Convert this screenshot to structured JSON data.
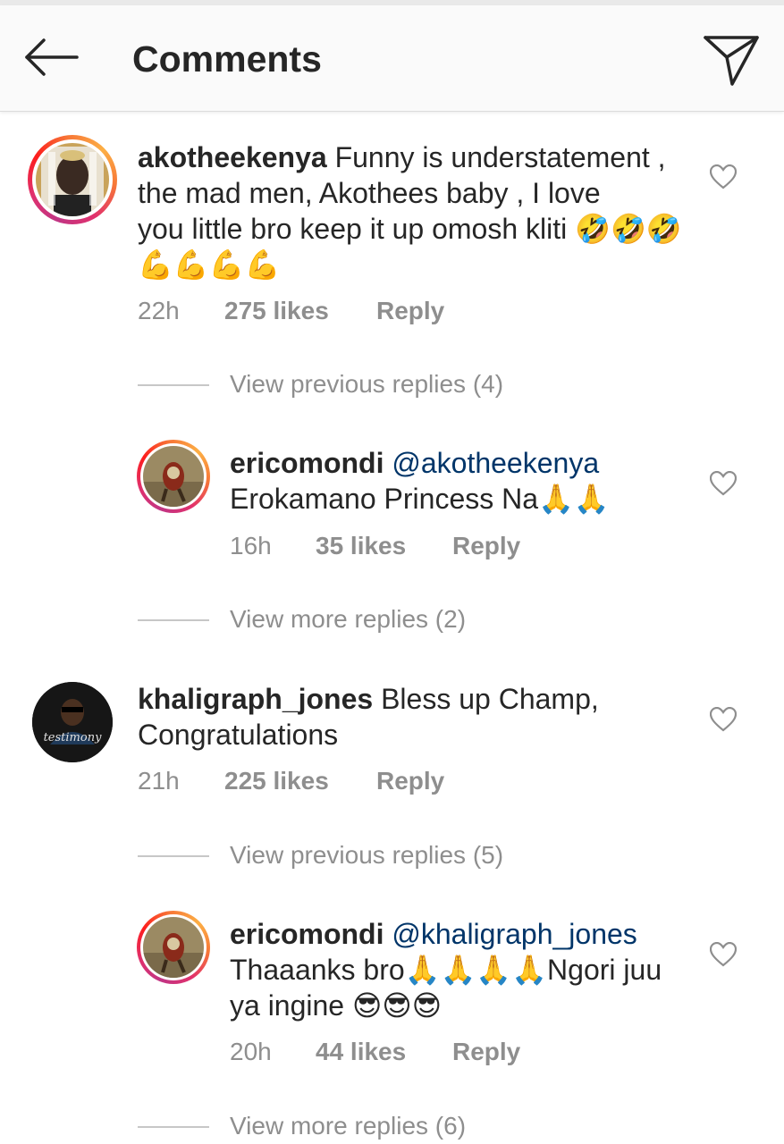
{
  "header": {
    "title": "Comments",
    "back_icon": "arrow-left-icon",
    "send_icon": "paper-plane-icon"
  },
  "comments": [
    {
      "username": "akotheekenya",
      "text_line1": " Funny is understatement ,",
      "text_line2": "the mad men,  Akothees baby , I love",
      "text_line3": "you little bro keep it up omosh kliti 🤣🤣🤣",
      "text_line4": "💪💪💪💪",
      "time": "22h",
      "likes": "275 likes",
      "reply": "Reply",
      "replies_link": "View previous replies (4)"
    },
    {
      "username": "ericomondi",
      "mention": "@akotheekenya",
      "text_line2": "Erokamano Princess Na🙏🙏",
      "time": "16h",
      "likes": "35 likes",
      "reply": "Reply",
      "replies_link": "View more replies (2)"
    },
    {
      "username": "khaligraph_jones",
      "text_line1": " Bless up Champ,",
      "text_line2": "Congratulations",
      "time": "21h",
      "likes": "225 likes",
      "reply": "Reply",
      "replies_link": "View previous replies (5)"
    },
    {
      "username": "ericomondi",
      "mention": "@khaligraph_jones",
      "text_line2": "Thaaanks bro🙏🙏🙏🙏Ngori juu",
      "text_line3": "ya ingine 😎😎😎",
      "time": "20h",
      "likes": "44 likes",
      "reply": "Reply",
      "replies_link": "View more replies (6)"
    }
  ],
  "colors": {
    "text": "#262626",
    "secondary": "#8e8e8e",
    "mention": "#003569",
    "header_bg": "#fafafa"
  }
}
